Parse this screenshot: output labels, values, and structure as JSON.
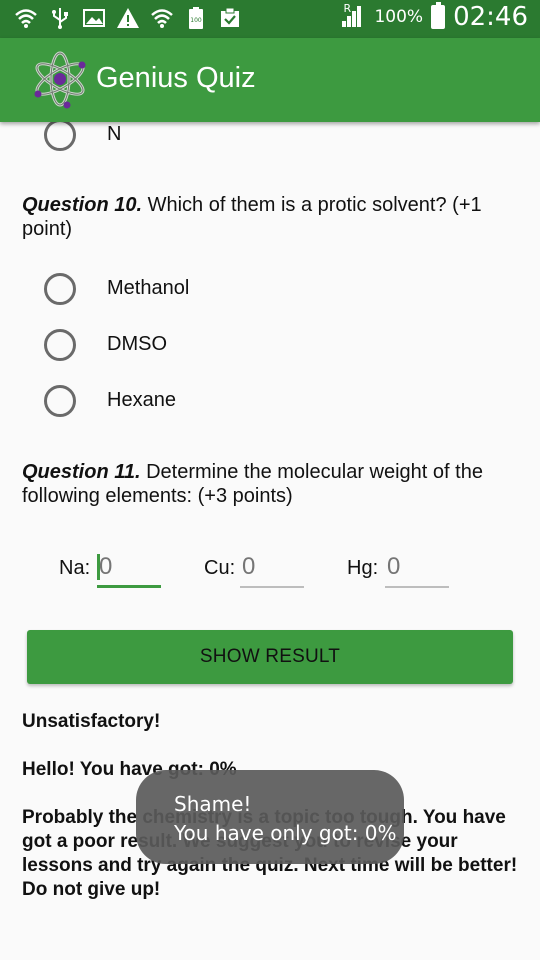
{
  "status_bar": {
    "battery_percent": "100%",
    "time": "02:46",
    "roaming_indicator": "R",
    "icons": [
      "wifi-icon",
      "usb-icon",
      "image-icon",
      "warning-icon",
      "wifi-icon",
      "battery-100-icon",
      "clipboard-check-icon"
    ]
  },
  "app_bar": {
    "title": "Genius Quiz",
    "logo": "atom-icon"
  },
  "quiz": {
    "prev_option_label": "N",
    "question10": {
      "number": "Question 10.",
      "text": " Which of them is a protic solvent? (+1 point)",
      "options": [
        "Methanol",
        "DMSO",
        "Hexane"
      ]
    },
    "question11": {
      "number": "Question 11.",
      "text": " Determine the molecular weight of the following elements: (+3 points)",
      "fields": [
        {
          "label": "Na:",
          "placeholder": "0"
        },
        {
          "label": "Cu:",
          "placeholder": "0"
        },
        {
          "label": "Hg:",
          "placeholder": "0"
        }
      ]
    },
    "show_result_label": "SHOW RESULT",
    "result": {
      "grade": "Unsatisfactory!",
      "score_line": "Hello! You have got: 0%",
      "message": "Probably the chemistry is a topic too tough. You have got a poor result. We suggest you to revise your lessons and try again the quiz. Next time will be better! Do not give up!"
    }
  },
  "toast": {
    "line1": "Shame!",
    "line2": "You have only got: 0%"
  },
  "colors": {
    "status_bar": "#2b7a30",
    "app_bar": "#3d9a40",
    "accent": "#3d9a40",
    "toast_bg": "#5a5a5a"
  }
}
